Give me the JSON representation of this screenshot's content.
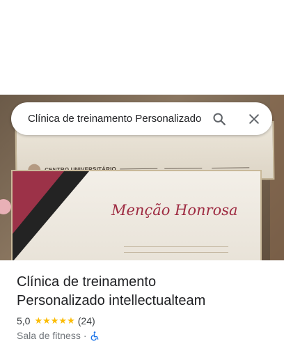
{
  "search": {
    "query": "Clínica de treinamento Personalizado intellectualteam"
  },
  "photo": {
    "certificate_title": "Menção Honrosa",
    "institution": "CENTRO UNIVERSITÁRIO"
  },
  "place": {
    "name_line1": "Clínica de treinamento",
    "name_line2": "Personalizado intellectualteam",
    "rating": "5,0",
    "stars": "★★★★★",
    "stars_value": 5,
    "review_count": "(24)",
    "category": "Sala de fitness",
    "separator": "·"
  },
  "icons": {
    "search": "search-icon",
    "close": "close-icon",
    "accessibility": "wheelchair-icon"
  },
  "colors": {
    "star": "#fbbc04",
    "accessible": "#1a73e8",
    "cert_title": "#9e2a41"
  }
}
